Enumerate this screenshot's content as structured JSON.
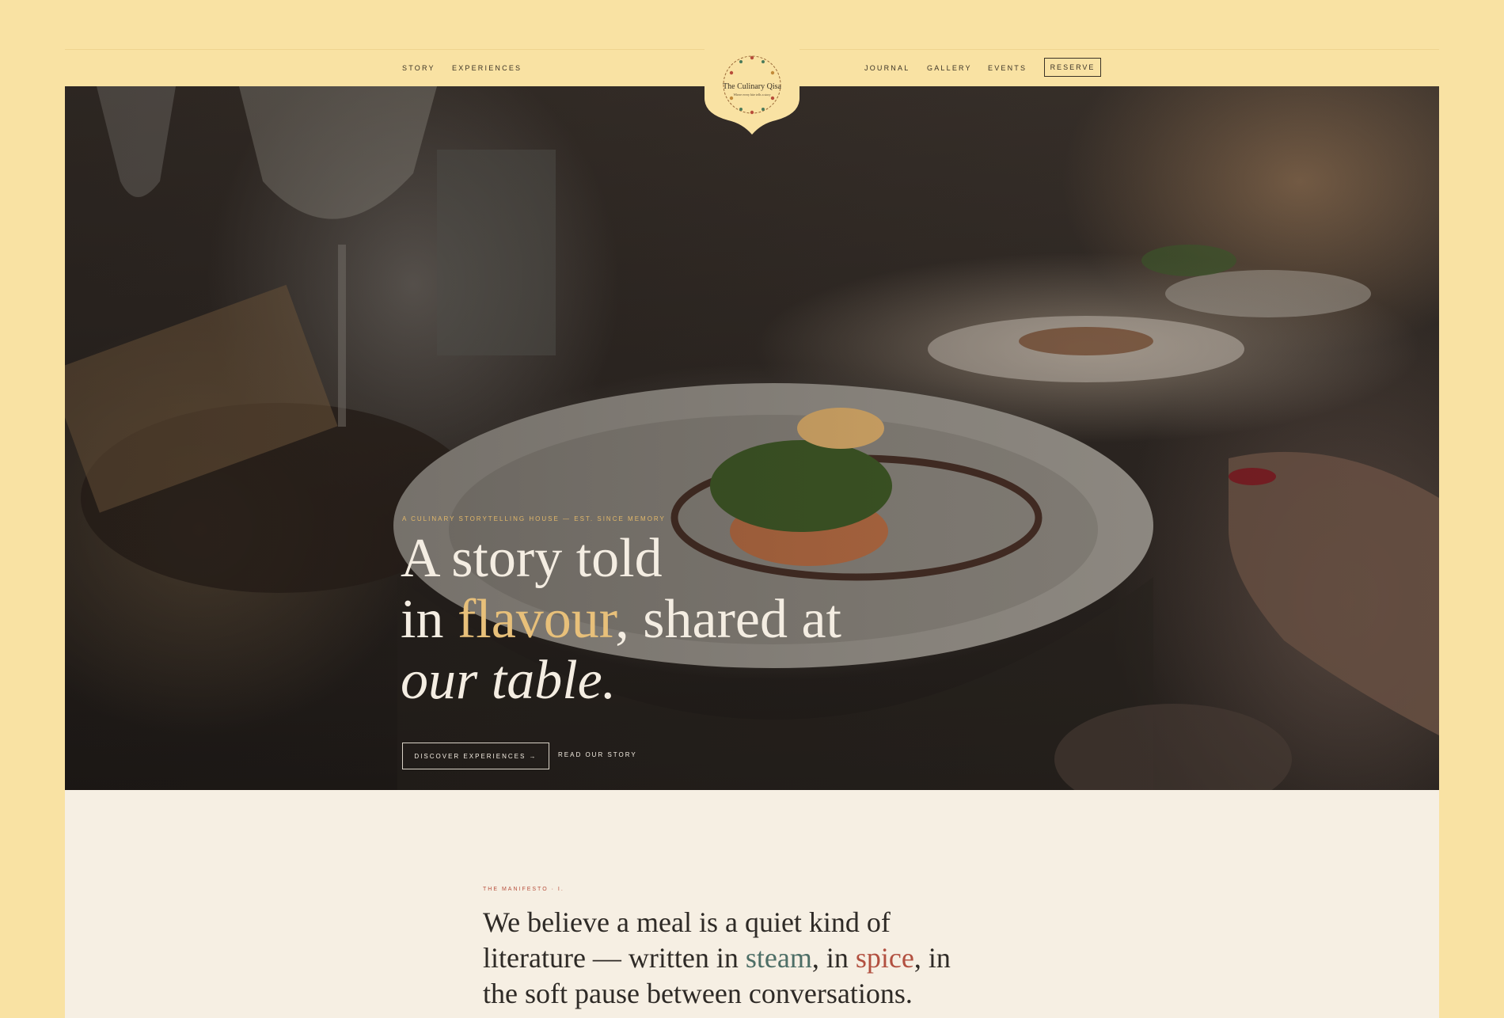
{
  "nav": {
    "left_links": [
      "STORY",
      "EXPERIENCES"
    ],
    "right_links": [
      "JOURNAL",
      "GALLERY",
      "EVENTS"
    ],
    "reserve_label": "RESERVE",
    "logo_name": "The Culinary Qisa",
    "logo_tagline": "Where every bite tells a story"
  },
  "hero": {
    "eyebrow": "A CULINARY STORYTELLING HOUSE — EST. SINCE MEMORY",
    "title_line1": "A story told",
    "title_in": "in ",
    "title_accent": "flavour",
    "title_rest": ", shared at",
    "title_italic": "our table.",
    "discover_label": "DISCOVER EXPERIENCES →",
    "read_label": "READ OUR STORY"
  },
  "manifesto": {
    "eyebrow": "THE MANIFESTO · I.",
    "line1": "We believe a meal is a quiet kind of",
    "line2_a": "literature — written in ",
    "line2_steam": "steam",
    "line2_b": ", in ",
    "line2_spice": "spice",
    "line2_c": ", in",
    "line3": "the soft pause between conversations."
  },
  "colors": {
    "frame_background": "#f9e2a3",
    "accent_gold": "#e8c07a",
    "steam": "#4d6e66",
    "spice": "#b25040"
  }
}
